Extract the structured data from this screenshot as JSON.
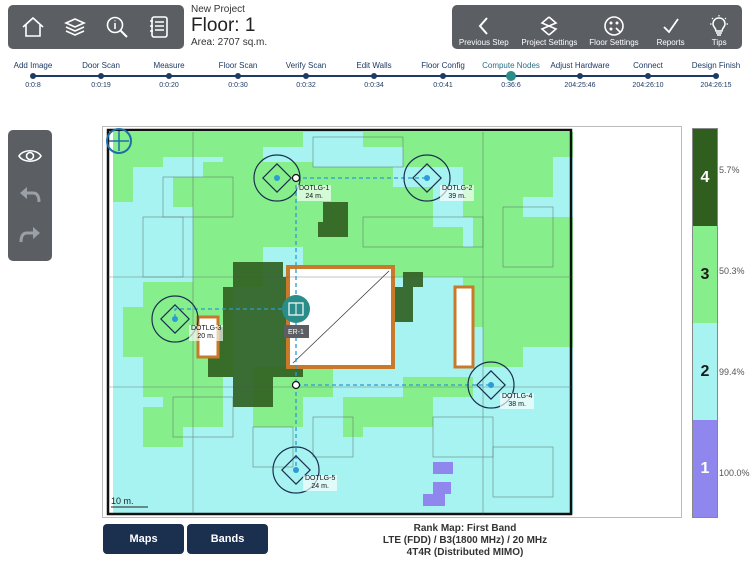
{
  "project": {
    "name": "New Project",
    "floor": "Floor: 1",
    "area": "Area: 2707 sq.m."
  },
  "toolbar_left": {
    "icons": [
      "home-icon",
      "layers-icon",
      "info-search-icon",
      "notes-icon"
    ]
  },
  "toolbar_right": {
    "buttons": [
      {
        "label": "Previous Step",
        "icon": "chevron-left-icon"
      },
      {
        "label": "Project Settings",
        "icon": "project-settings-icon"
      },
      {
        "label": "Floor Settings",
        "icon": "floor-settings-icon"
      },
      {
        "label": "Reports",
        "icon": "checkmark-icon"
      },
      {
        "label": "Tips",
        "icon": "lightbulb-icon"
      }
    ]
  },
  "workflow": {
    "steps": [
      {
        "name": "Add Image",
        "time": "0:0:8"
      },
      {
        "name": "Door Scan",
        "time": "0:0:19"
      },
      {
        "name": "Measure",
        "time": "0:0:20"
      },
      {
        "name": "Floor Scan",
        "time": "0:0:30"
      },
      {
        "name": "Verify Scan",
        "time": "0:0:32"
      },
      {
        "name": "Edit Walls",
        "time": "0:0:34"
      },
      {
        "name": "Floor Config",
        "time": "0:0:41"
      },
      {
        "name": "Compute Nodes",
        "time": "0:36:6",
        "active": true
      },
      {
        "name": "Adjust Hardware",
        "time": "204:25:46"
      },
      {
        "name": "Connect",
        "time": "204:26:10"
      },
      {
        "name": "Design Finish",
        "time": "204:26:15"
      }
    ]
  },
  "side_tools": [
    "eye-icon",
    "undo-icon",
    "redo-icon"
  ],
  "map": {
    "scale_label": "10 m.",
    "nodes": [
      {
        "name": "DOTLG-1",
        "dist": "24 m."
      },
      {
        "name": "DOTLG-2",
        "dist": "39 m."
      },
      {
        "name": "DOTLG-3",
        "dist": "20 m."
      },
      {
        "name": "DOTLG-4",
        "dist": "38 m."
      },
      {
        "name": "DOTLG-5",
        "dist": "24 m."
      }
    ],
    "equipment_room": "ER-1"
  },
  "legend": [
    {
      "rank": "4",
      "pct": "5.7%",
      "color": "#2f5e1e",
      "text_color": "#ffffff"
    },
    {
      "rank": "3",
      "pct": "50.3%",
      "color": "#86ef8c",
      "text_color": "#1a1a1a"
    },
    {
      "rank": "2",
      "pct": "99.4%",
      "color": "#a6f3f1",
      "text_color": "#1a1a1a"
    },
    {
      "rank": "1",
      "pct": "100.0%",
      "color": "#8f87ee",
      "text_color": "#ffffff"
    }
  ],
  "bottom": {
    "maps_label": "Maps",
    "bands_label": "Bands",
    "rank_title": "Rank Map: First Band",
    "band": "LTE (FDD) / B3(1800 MHz) / 20 MHz",
    "mimo": "4T4R (Distributed MIMO)"
  },
  "colors": {
    "toolbar": "#5b5e63",
    "accent": "#1f3a63",
    "active_step": "#2a8d8a",
    "button": "#1b2f4f"
  }
}
